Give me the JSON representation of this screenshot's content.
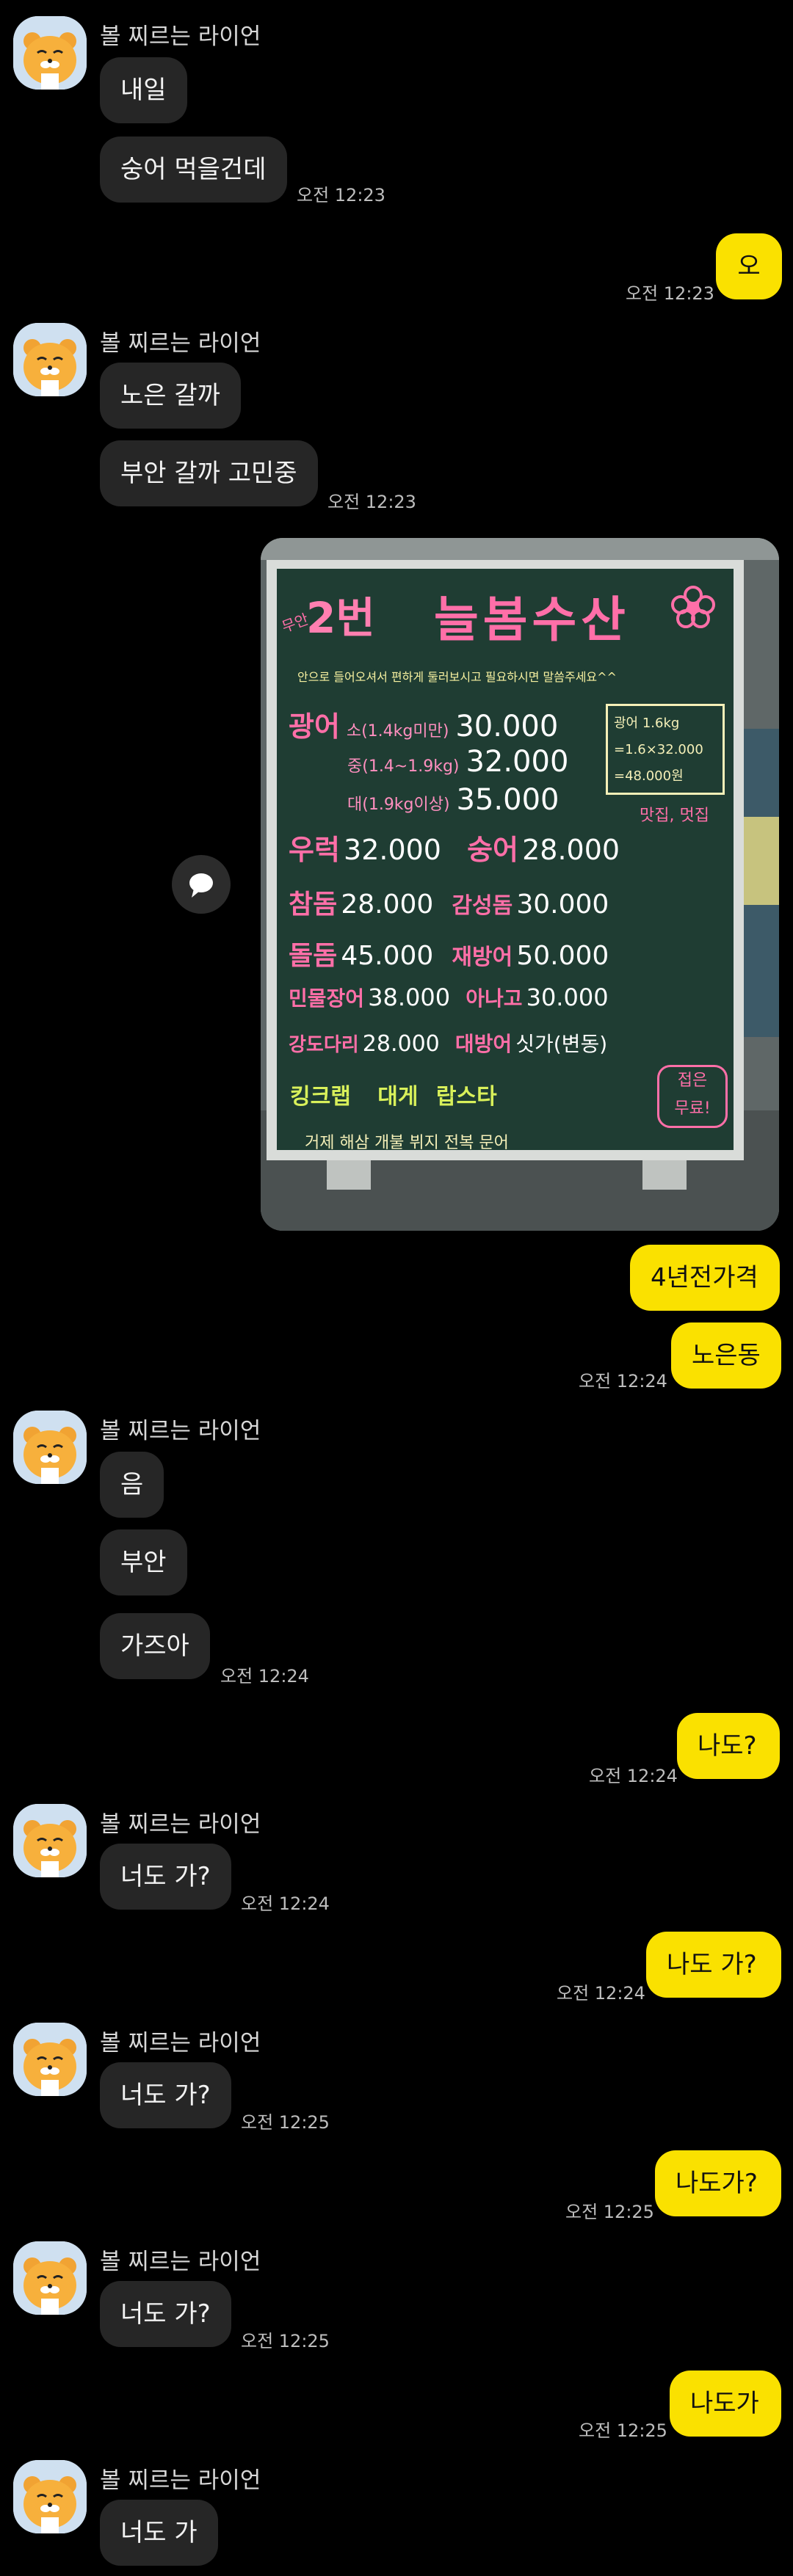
{
  "chat": {
    "sender_name": "볼 찌르는 라이언",
    "messages": [
      {
        "text": "내일"
      },
      {
        "text": "숭어 먹을건데",
        "time": "오전 12:23"
      },
      {
        "text": "오",
        "time": "오전 12:23"
      },
      {
        "text": "노은 갈까"
      },
      {
        "text": "부안 갈까 고민중",
        "time": "오전 12:23"
      },
      {
        "text": "4년전가격"
      },
      {
        "text": "노은동",
        "time": "오전 12:24"
      },
      {
        "text": "음"
      },
      {
        "text": "부안"
      },
      {
        "text": "가즈아",
        "time": "오전 12:24"
      },
      {
        "text": "나도?",
        "time": "오전 12:24"
      },
      {
        "text": "너도 가?",
        "time": "오전 12:24"
      },
      {
        "text": "나도 가?",
        "time": "오전 12:24"
      },
      {
        "text": "너도 가?",
        "time": "오전 12:25"
      },
      {
        "text": "나도가?",
        "time": "오전 12:25"
      },
      {
        "text": "너도 가?",
        "time": "오전 12:25"
      },
      {
        "text": "나도가",
        "time": "오전 12:25"
      },
      {
        "text": "너도 가"
      }
    ]
  },
  "board": {
    "badge": "무안",
    "number": "2번",
    "shop_name": "늘봄수산",
    "intro": "안으로 들어오셔서 편하게 둘러보시고 필요하시면 말씀주세요^^",
    "rows": [
      {
        "name": "광어",
        "size": "소(1.4kg미만)",
        "price": "30.000"
      },
      {
        "name": "",
        "size": "중(1.4~1.9kg)",
        "price": "32.000"
      },
      {
        "name": "",
        "size": "대(1.9kg이상)",
        "price": "35.000"
      },
      {
        "name": "우럭",
        "price": "32.000",
        "name2": "숭어",
        "price2": "28.000"
      },
      {
        "name": "참돔",
        "price": "28.000",
        "name2": "감성돔",
        "price2": "30.000"
      },
      {
        "name": "돌돔",
        "price": "45.000",
        "name2": "재방어",
        "price2": "50.000"
      },
      {
        "name": "민물장어",
        "price": "38.000",
        "name2": "아나고",
        "price2": "30.000"
      },
      {
        "name": "강도다리",
        "price": "28.000",
        "name2": "대방어",
        "price2": "싯가(변동)"
      }
    ],
    "boxed_note": [
      "광어 1.6kg",
      "=1.6×32.000",
      "=48.000원"
    ],
    "note_under": "맛집, 멋집",
    "specials": [
      "킹크랩",
      "대게",
      "랍스타"
    ],
    "free_note": [
      "접은",
      "무료!"
    ],
    "bottom": "거제 해삼 개불 뷔지 전복 문어"
  },
  "colors": {
    "background": "#000000",
    "incoming_bubble": "#262626",
    "outgoing_bubble": "#fae100",
    "chalkboard": "#1f3d33",
    "chalk_pink": "#ff6fa8"
  }
}
